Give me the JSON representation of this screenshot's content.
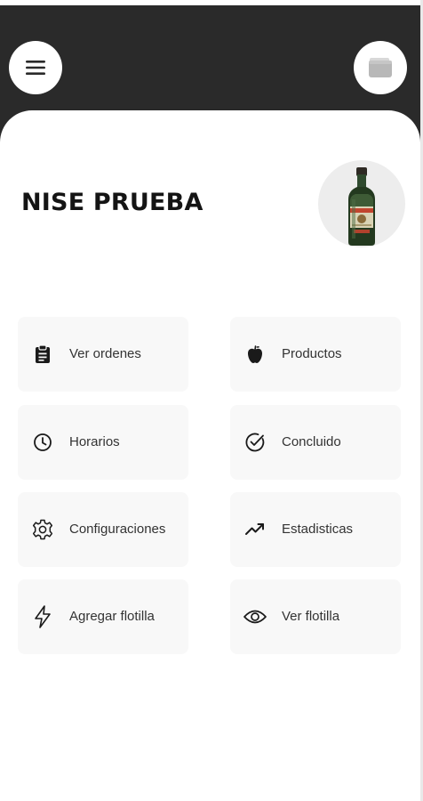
{
  "header": {
    "background": "#2a2a2a",
    "menu_icon": "hamburger-menu-icon",
    "wallet_icon": "wallet-icon"
  },
  "store": {
    "name": "NISE PRUEBA",
    "avatar": "liquor-bottle-image"
  },
  "menu_tiles": [
    {
      "label": "Ver ordenes",
      "icon": "clipboard-icon"
    },
    {
      "label": "Productos",
      "icon": "apple-icon"
    },
    {
      "label": "Horarios",
      "icon": "clock-icon"
    },
    {
      "label": "Concluido",
      "icon": "check-circle-icon"
    },
    {
      "label": "Configuraciones",
      "icon": "gear-icon"
    },
    {
      "label": "Estadisticas",
      "icon": "trending-up-icon"
    },
    {
      "label": "Agregar flotilla",
      "icon": "lightning-icon"
    },
    {
      "label": "Ver flotilla",
      "icon": "eye-icon"
    }
  ],
  "colors": {
    "tile_background": "#f8f8f8",
    "text": "#333333",
    "title": "#141414"
  }
}
